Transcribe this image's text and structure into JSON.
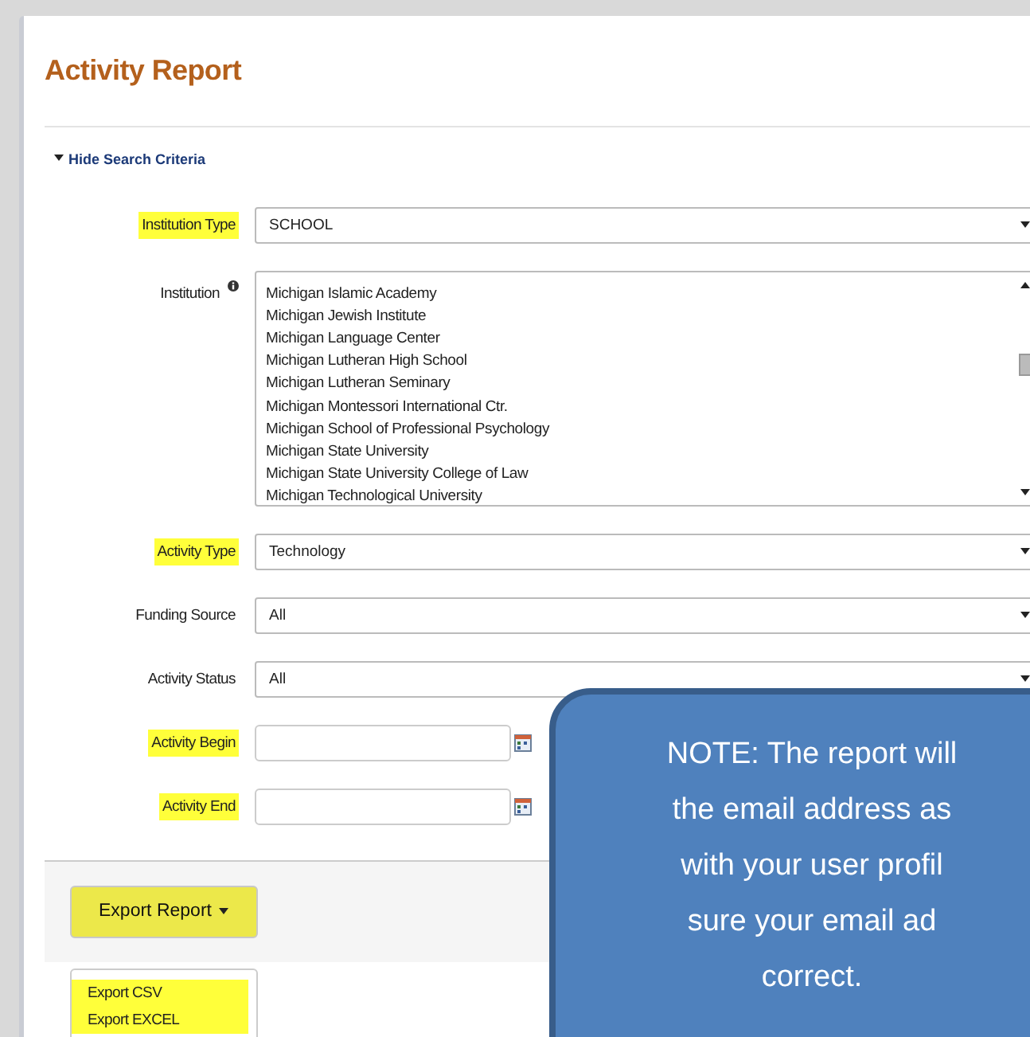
{
  "title": "Activity Report",
  "toggle": {
    "label": "Hide Search Criteria",
    "expanded": true
  },
  "fields": [
    {
      "kind": "select",
      "label": "Institution Type",
      "highlighted": true,
      "value": "SCHOOL"
    },
    {
      "kind": "listbox",
      "label": "Institution",
      "highlighted": false,
      "info": true,
      "options": [
        "Michigan Islamic Academy",
        "Michigan Jewish Institute",
        "Michigan Language Center",
        "Michigan Lutheran High School",
        "Michigan Lutheran Seminary",
        "Michigan Montessori International Ctr.",
        "Michigan School of Professional Psychology",
        "Michigan State University",
        "Michigan State University College of Law",
        "Michigan Technological University"
      ]
    },
    {
      "kind": "select",
      "label": "Activity Type",
      "highlighted": true,
      "value": "Technology"
    },
    {
      "kind": "select",
      "label": "Funding Source",
      "highlighted": false,
      "value": "All"
    },
    {
      "kind": "select",
      "label": "Activity Status",
      "highlighted": false,
      "value": "All"
    },
    {
      "kind": "date",
      "label": "Activity Begin",
      "highlighted": true
    },
    {
      "kind": "date",
      "label": "Activity End",
      "highlighted": true
    }
  ],
  "export": {
    "label": "Export Report",
    "highlighted": true,
    "menu": [
      {
        "label": "Export CSV",
        "highlighted": true
      },
      {
        "label": "Export EXCEL",
        "highlighted": true
      }
    ]
  },
  "note": {
    "lines": [
      "NOTE:  The report will",
      "the email address as",
      "with your user profil",
      "sure your email ad",
      "correct."
    ]
  }
}
